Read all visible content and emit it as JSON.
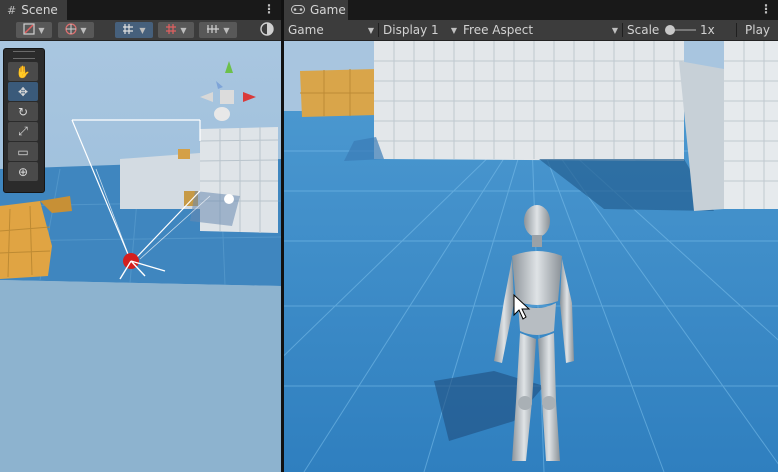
{
  "scene": {
    "tab_label": "Scene",
    "toolbar_icons": [
      "shading-mode-icon",
      "globe-icon",
      "grid-snap-icon",
      "grid-icon",
      "overlay-icon",
      "orientation-icon"
    ],
    "tools": [
      "hand-tool-icon",
      "move-tool-icon",
      "rotate-tool-icon",
      "scale-tool-icon",
      "rect-tool-icon",
      "transform-tool-icon"
    ]
  },
  "game": {
    "tab_label": "Game",
    "mode": "Game",
    "display": "Display 1",
    "aspect": "Free Aspect",
    "scale_label": "Scale",
    "scale_value": "1x",
    "play_label": "Play"
  },
  "colors": {
    "ground": "#3d86c2",
    "sky": "#a9c6e0",
    "accent_active": "#46607c",
    "crate": "#d9a54a"
  }
}
